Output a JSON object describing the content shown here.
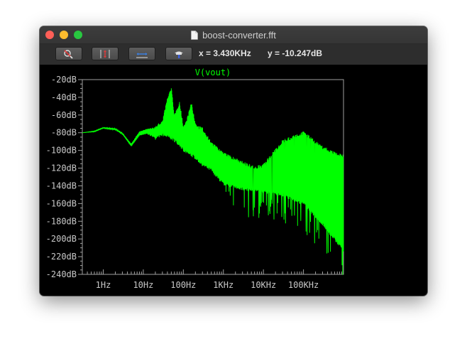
{
  "window": {
    "title": "boost-converter.fft"
  },
  "toolbar": {
    "buttons": [
      {
        "name": "zoom-cancel",
        "icon": "magnifier-cancel-icon"
      },
      {
        "name": "autorange-y",
        "icon": "vertical-autorange-icon"
      },
      {
        "name": "autorange-x",
        "icon": "horizontal-autorange-icon"
      },
      {
        "name": "pan",
        "icon": "hand-pan-icon"
      }
    ],
    "readout_x": "x = 3.430KHz",
    "readout_y": "y = -10.247dB"
  },
  "colors": {
    "trace": "#00ff00",
    "axis": "#a0a0a0",
    "background": "#000000",
    "label": "#c8c8c8"
  },
  "chart_data": {
    "type": "line",
    "title": "V(vout)",
    "x_scale": "log",
    "xlim_hz": [
      0.3,
      1000000
    ],
    "ylim_db": [
      -240,
      -20
    ],
    "y_ticks": [
      -20,
      -40,
      -60,
      -80,
      -100,
      -120,
      -140,
      -160,
      -180,
      -200,
      -220,
      -240
    ],
    "y_tick_labels": [
      "-20dB",
      "-40dB",
      "-60dB",
      "-80dB",
      "-100dB",
      "-120dB",
      "-140dB",
      "-160dB",
      "-180dB",
      "-200dB",
      "-220dB",
      "-240dB"
    ],
    "x_ticks_hz": [
      1,
      10,
      100,
      1000,
      10000,
      100000
    ],
    "x_tick_labels": [
      "1Hz",
      "10Hz",
      "100Hz",
      "1KHz",
      "10KHz",
      "100KHz"
    ],
    "series": [
      {
        "name": "V(vout)",
        "envelope_upper": [
          [
            0.3,
            -80
          ],
          [
            0.6,
            -78
          ],
          [
            1.0,
            -74
          ],
          [
            2.0,
            -75
          ],
          [
            3.0,
            -80
          ],
          [
            5.0,
            -92
          ],
          [
            8.0,
            -78
          ],
          [
            12,
            -75
          ],
          [
            20,
            -72
          ],
          [
            30,
            -66
          ],
          [
            40,
            -40
          ],
          [
            50,
            -28
          ],
          [
            60,
            -60
          ],
          [
            80,
            -44
          ],
          [
            100,
            -72
          ],
          [
            120,
            -65
          ],
          [
            160,
            -45
          ],
          [
            200,
            -70
          ],
          [
            300,
            -74
          ],
          [
            500,
            -90
          ],
          [
            1000,
            -102
          ],
          [
            3000,
            -112
          ],
          [
            6000,
            -118
          ],
          [
            10000,
            -115
          ],
          [
            30000,
            -88
          ],
          [
            100000,
            -78
          ],
          [
            300000,
            -95
          ],
          [
            1000000,
            -105
          ]
        ],
        "envelope_lower": [
          [
            0.3,
            -80
          ],
          [
            0.6,
            -79
          ],
          [
            1.0,
            -75
          ],
          [
            2.0,
            -77
          ],
          [
            3.0,
            -82
          ],
          [
            5.0,
            -96
          ],
          [
            8.0,
            -84
          ],
          [
            12,
            -82
          ],
          [
            20,
            -88
          ],
          [
            30,
            -84
          ],
          [
            50,
            -88
          ],
          [
            80,
            -95
          ],
          [
            100,
            -102
          ],
          [
            200,
            -110
          ],
          [
            300,
            -118
          ],
          [
            500,
            -124
          ],
          [
            1000,
            -140
          ],
          [
            3000,
            -145
          ],
          [
            10000,
            -148
          ],
          [
            30000,
            -152
          ],
          [
            100000,
            -162
          ],
          [
            300000,
            -185
          ],
          [
            1000000,
            -215
          ]
        ]
      }
    ]
  }
}
